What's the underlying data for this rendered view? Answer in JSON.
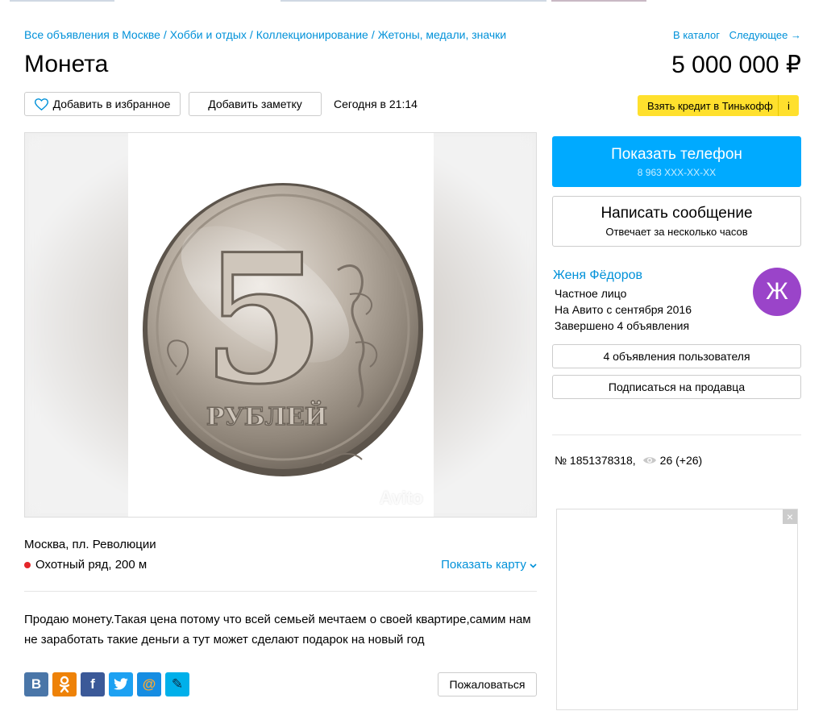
{
  "breadcrumb": {
    "items": [
      "Все объявления в Москве",
      "Хобби и отдых",
      "Коллекционирование",
      "Жетоны, медали, значки"
    ],
    "separator": "/"
  },
  "nav": {
    "catalog": "В каталог",
    "next": "Следующее →"
  },
  "listing": {
    "title": "Монета",
    "price": "5 000 000 ₽",
    "favorite_label": "Добавить в избранное",
    "note_label": "Добавить заметку",
    "date": "Сегодня в 21:14",
    "description": "Продаю монету.Такая цена потому что всей семьей мечтаем о своей квартире,самим нам не заработать такие деньги а тут может сделают подарок на новый год"
  },
  "credit": {
    "label": "Взять кредит в Тинькофф",
    "info": "i",
    "color": "#ffe02d"
  },
  "gallery": {
    "watermark": "Avito",
    "coin_text": "РУБЛЕЙ",
    "coin_value": "5"
  },
  "contact": {
    "show_phone": "Показать телефон",
    "phone_mask": "8 963 XXX-XX-XX",
    "write": "Написать сообщение",
    "write_sub": "Отвечает за несколько часов",
    "accent": "#00aaff"
  },
  "seller": {
    "name": "Женя Фёдоров",
    "type": "Частное лицо",
    "since": "На Авито с сентября 2016",
    "completed": "Завершено 4 объявления",
    "avatar_letter": "Ж",
    "avatar_color": "#9a44c9",
    "ads_button": "4 объявления пользователя",
    "subscribe_button": "Подписаться на продавца"
  },
  "meta": {
    "number": "№ 1851378318,",
    "views": "26 (+26)",
    "views_icon": "eye-icon"
  },
  "ad": {
    "close": "×"
  },
  "location": {
    "address": "Москва, пл. Революции",
    "metro": "Охотный ряд, 200 м",
    "metro_color": "#e4262a",
    "show_map": "Показать карту"
  },
  "share": {
    "buttons": [
      {
        "name": "vk",
        "glyph": "В",
        "color": "#4a76a8"
      },
      {
        "name": "ok",
        "glyph": "ОК",
        "color": "#ee8208"
      },
      {
        "name": "facebook",
        "glyph": "f",
        "color": "#3b5998"
      },
      {
        "name": "twitter",
        "glyph": "t",
        "color": "#1da1f2"
      },
      {
        "name": "mail",
        "glyph": "@",
        "color": "#168de2"
      },
      {
        "name": "livejournal",
        "glyph": "✎",
        "color": "#00b0ea"
      }
    ]
  },
  "complain": "Пожаловаться"
}
